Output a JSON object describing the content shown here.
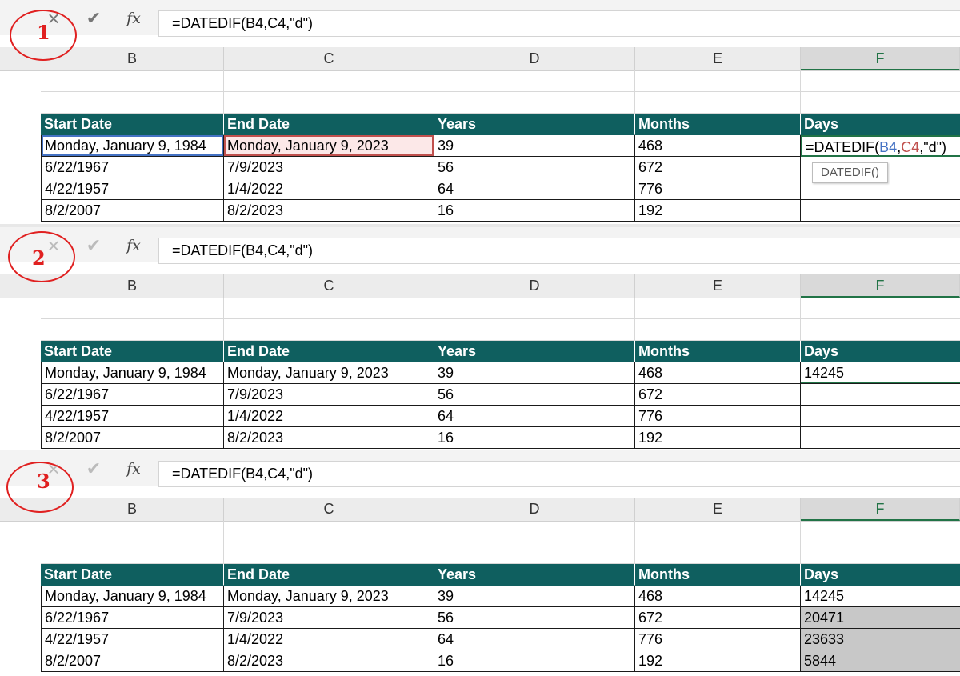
{
  "formula": "=DATEDIF(B4,C4,\"d\")",
  "formula_parts": {
    "prefix": "=DATEDIF(",
    "ref1": "B4",
    "comma": ",",
    "ref2": "C4",
    "suffix": ",\"d\")"
  },
  "icons": {
    "cancel": "×",
    "enter": "✔",
    "fx": "fx"
  },
  "tooltip": "DATEDIF()",
  "columns": [
    "B",
    "C",
    "D",
    "E",
    "F"
  ],
  "headers": [
    "Start Date",
    "End Date",
    "Years",
    "Months",
    "Days"
  ],
  "rows": [
    [
      "Monday, January 9, 1984",
      "Monday, January 9, 2023",
      "39",
      "468"
    ],
    [
      "6/22/1967",
      "7/9/2023",
      "56",
      "672"
    ],
    [
      "4/22/1957",
      "1/4/2022",
      "64",
      "776"
    ],
    [
      "8/2/2007",
      "8/2/2023",
      "16",
      "192"
    ]
  ],
  "days_results": [
    "14245",
    "20471",
    "23633",
    "5844"
  ],
  "steps": [
    "1",
    "2",
    "3"
  ],
  "colors": {
    "header_fill": "#0f5f5f",
    "accent_green": "#217346",
    "step_red": "#e02020",
    "ref_blue": "#4472c4",
    "ref_red": "#c0504d"
  }
}
